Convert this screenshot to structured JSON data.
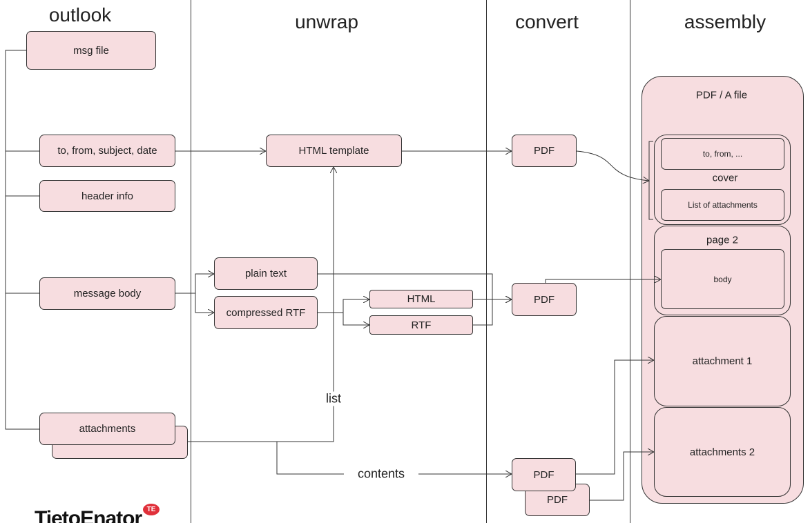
{
  "columns": {
    "outlook": "outlook",
    "unwrap": "unwrap",
    "convert": "convert",
    "assembly": "assembly"
  },
  "outlook": {
    "msg_file": "msg file",
    "fields": "to, from, subject, date",
    "header_info": "header info",
    "message_body": "message body",
    "attachments": "attachments"
  },
  "unwrap": {
    "html_template": "HTML  template",
    "plain_text": "plain text",
    "compressed_rtf": "compressed RTF",
    "html": "HTML",
    "rtf": "RTF",
    "list_label": "list",
    "contents_label": "contents"
  },
  "convert": {
    "pdf1": "PDF",
    "pdf2": "PDF",
    "pdf3": "PDF",
    "pdf4": "PDF"
  },
  "assembly": {
    "file": "PDF / A file",
    "cover_fields": "to, from, ...",
    "cover": "cover",
    "list_of_attachments": "List of attachments",
    "page2": "page 2",
    "body": "body",
    "attachment1": "attachment  1",
    "attachment2": "attachments  2"
  },
  "logo": {
    "text": "TietoEnator",
    "badge": "TE"
  },
  "colors": {
    "box_fill": "#f7dde0",
    "line": "#333333",
    "logo_badge": "#e0303a"
  }
}
